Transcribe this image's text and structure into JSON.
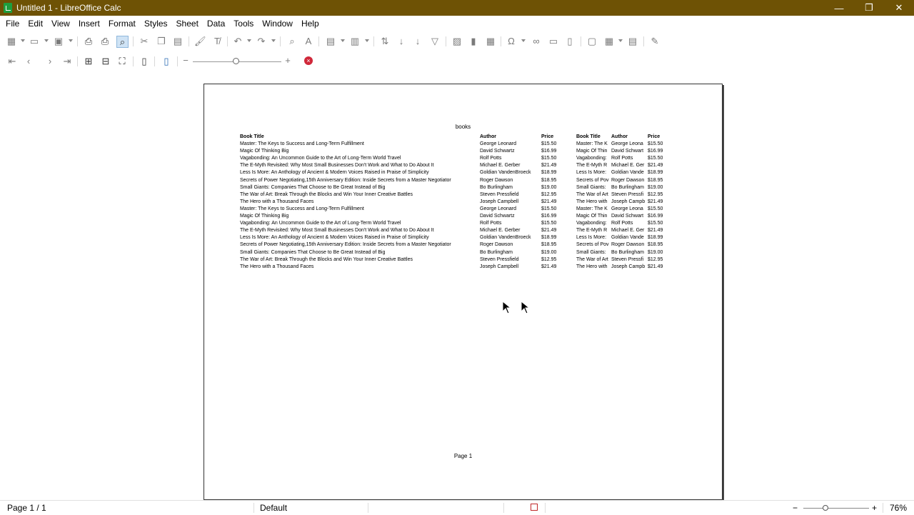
{
  "window": {
    "title": "Untitled 1 - LibreOffice Calc",
    "minimize": "—",
    "restore": "❐",
    "close": "✕"
  },
  "menu": [
    "File",
    "Edit",
    "View",
    "Insert",
    "Format",
    "Styles",
    "Sheet",
    "Data",
    "Tools",
    "Window",
    "Help"
  ],
  "toolbar_icons": [
    "new-icon",
    "open-icon",
    "save-icon",
    "export-pdf-icon",
    "print-icon",
    "print-preview-icon",
    "cut-icon",
    "copy-icon",
    "paste-icon",
    "clone-formatting-icon",
    "clear-formatting-icon",
    "undo-icon",
    "redo-icon",
    "find-replace-icon",
    "spelling-icon",
    "row-icon",
    "column-icon",
    "sort-icon",
    "sort-ascending-icon",
    "sort-descending-icon",
    "autofilter-icon",
    "image-icon",
    "chart-icon",
    "pivot-table-icon",
    "special-character-icon",
    "hyperlink-icon",
    "comment-icon",
    "headers-footers-icon",
    "define-print-area-icon",
    "freeze-rows-columns-icon",
    "split-window-icon",
    "show-draw-functions-icon"
  ],
  "preview": {
    "zoom_minus": "−",
    "zoom_plus": "+",
    "close_preview": "×"
  },
  "page": {
    "title": "books",
    "footer": "Page 1",
    "headers": [
      "Book Title",
      "Author",
      "Price",
      "Book Title",
      "Author",
      "Price"
    ],
    "rows": [
      [
        "Master: The Keys to Success and Long-Term Fulfillment",
        "George Leonard",
        "$15.50",
        "Master: The K",
        "George Leona",
        "$15.50"
      ],
      [
        "Magic Of Thinking Big",
        "David Schwartz",
        "$16.99",
        "Magic Of Thin",
        "David Schwart",
        "$16.99"
      ],
      [
        "Vagabonding: An Uncommon Guide to the Art of Long-Term World Travel",
        "Rolf Potts",
        "$15.50",
        "Vagabonding:",
        "Rolf Potts",
        "$15.50"
      ],
      [
        "The E-Myth Revisited: Why Most Small Businesses Don't Work and What to Do About It",
        "Michael E. Gerber",
        "$21.49",
        "The E-Myth R",
        "Michael E. Ger",
        "$21.49"
      ],
      [
        "Less Is More: An Anthology of Ancient & Modern Voices Raised in Praise of Simplicity",
        "Goldian VandenBroeck",
        "$18.99",
        "Less Is More:",
        "Goldian Vande",
        "$18.99"
      ],
      [
        "Secrets of Power Negotiating,15th Anniversary Edition: Inside Secrets from a Master Negotiator",
        "Roger Dawson",
        "$18.95",
        "Secrets of Pov",
        "Roger Dawson",
        "$18.95"
      ],
      [
        "Small Giants: Companies That Choose to Be Great Instead of Big",
        "Bo Burlingham",
        "$19.00",
        "Small Giants:",
        "Bo Burlingham",
        "$19.00"
      ],
      [
        "The War of Art: Break Through the Blocks and Win Your Inner Creative Battles",
        "Steven Pressfield",
        "$12.95",
        "The War of Art",
        "Steven Pressfi",
        "$12.95"
      ],
      [
        "The Hero with a Thousand Faces",
        "Joseph Campbell",
        "$21.49",
        "The Hero with",
        "Joseph Campb",
        "$21.49"
      ],
      [
        "Master: The Keys to Success and Long-Term Fulfillment",
        "George Leonard",
        "$15.50",
        "Master: The K",
        "George Leona",
        "$15.50"
      ],
      [
        "Magic Of Thinking Big",
        "David Schwartz",
        "$16.99",
        "Magic Of Thin",
        "David Schwart",
        "$16.99"
      ],
      [
        "Vagabonding: An Uncommon Guide to the Art of Long-Term World Travel",
        "Rolf Potts",
        "$15.50",
        "Vagabonding:",
        "Rolf Potts",
        "$15.50"
      ],
      [
        "The E-Myth Revisited: Why Most Small Businesses Don't Work and What to Do About It",
        "Michael E. Gerber",
        "$21.49",
        "The E-Myth R",
        "Michael E. Ger",
        "$21.49"
      ],
      [
        "Less Is More: An Anthology of Ancient & Modern Voices Raised in Praise of Simplicity",
        "Goldian VandenBroeck",
        "$18.99",
        "Less Is More:",
        "Goldian Vande",
        "$18.99"
      ],
      [
        "Secrets of Power Negotiating,15th Anniversary Edition: Inside Secrets from a Master Negotiator",
        "Roger Dawson",
        "$18.95",
        "Secrets of Pov",
        "Roger Dawson",
        "$18.95"
      ],
      [
        "Small Giants: Companies That Choose to Be Great Instead of Big",
        "Bo Burlingham",
        "$19.00",
        "Small Giants:",
        "Bo Burlingham",
        "$19.00"
      ],
      [
        "The War of Art: Break Through the Blocks and Win Your Inner Creative Battles",
        "Steven Pressfield",
        "$12.95",
        "The War of Art",
        "Steven Pressfi",
        "$12.95"
      ],
      [
        "The Hero with a Thousand Faces",
        "Joseph Campbell",
        "$21.49",
        "The Hero with",
        "Joseph Campb",
        "$21.49"
      ]
    ]
  },
  "status": {
    "page": "Page 1 / 1",
    "style": "Default",
    "zoom": "76%",
    "zoom_minus": "−",
    "zoom_plus": "+"
  },
  "colors": {
    "titlebar": "#6e5205",
    "close_preview": "#d0283a"
  }
}
